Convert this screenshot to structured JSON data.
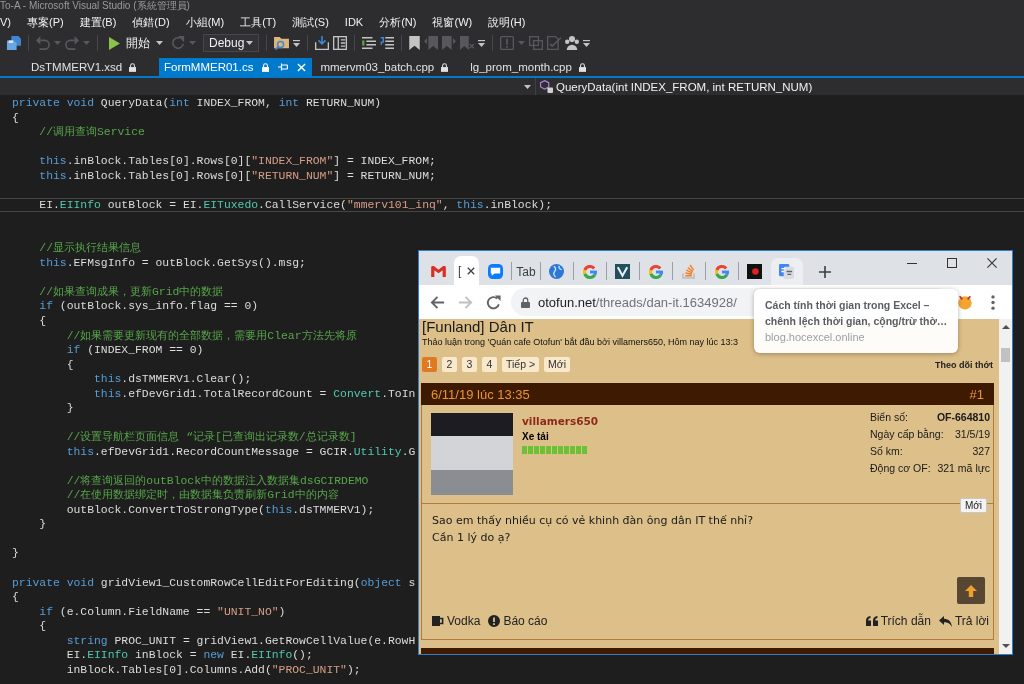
{
  "window": {
    "title": "To-A - Microsoft Visual Studio (系統管理員)"
  },
  "menu": [
    "V)",
    "專案(P)",
    "建置(B)",
    "偵錯(D)",
    "小組(M)",
    "工具(T)",
    "測試(S)",
    "IDK",
    "分析(N)",
    "視窗(W)",
    "說明(H)"
  ],
  "toolbar": {
    "groups": [
      [
        {
          "kind": "save",
          "disabled": false,
          "dropdown": false
        }
      ],
      [
        {
          "kind": "undo",
          "disabled": true,
          "dropdown": true
        },
        {
          "kind": "redo",
          "disabled": true,
          "dropdown": true
        }
      ],
      [
        {
          "kind": "start",
          "label": "開始",
          "disabled": false,
          "dropdown": true
        },
        {
          "kind": "restart",
          "disabled": true,
          "dropdown": true
        },
        {
          "kind": "combo",
          "value": "Debug",
          "disabled": false,
          "dropdown": true
        }
      ],
      [
        {
          "kind": "find",
          "disabled": false,
          "dropdown": false
        },
        {
          "kind": "overflow",
          "disabled": false,
          "dropdown": false
        }
      ],
      [
        {
          "kind": "tray",
          "disabled": false,
          "dropdown": false
        },
        {
          "kind": "panel",
          "disabled": false,
          "dropdown": false
        }
      ],
      [
        {
          "kind": "comment",
          "disabled": false,
          "dropdown": false
        },
        {
          "kind": "uncomment",
          "disabled": false,
          "dropdown": false
        }
      ],
      [
        {
          "kind": "bookmark",
          "disabled": false,
          "dropdown": false
        },
        {
          "kind": "bookmark_prev",
          "disabled": true,
          "dropdown": false
        },
        {
          "kind": "bookmark_next",
          "disabled": true,
          "dropdown": false
        },
        {
          "kind": "bookmark_clear",
          "disabled": true,
          "dropdown": false
        },
        {
          "kind": "overflow",
          "disabled": false,
          "dropdown": false
        }
      ],
      [
        {
          "kind": "alert",
          "disabled": true,
          "dropdown": true
        },
        {
          "kind": "layers",
          "disabled": true,
          "dropdown": false
        },
        {
          "kind": "checklist",
          "disabled": true,
          "dropdown": false
        },
        {
          "kind": "team",
          "disabled": false,
          "dropdown": false
        },
        {
          "kind": "overflow",
          "disabled": false,
          "dropdown": false
        }
      ]
    ]
  },
  "tabs": [
    {
      "title": "DsTMMERV1.xsd",
      "selected": false,
      "locked": true
    },
    {
      "title": "FormMMER01.cs",
      "selected": true,
      "locked": true
    },
    {
      "title": "mmervm03_batch.cpp",
      "selected": false,
      "locked": true
    },
    {
      "title": "lg_prom_month.cpp",
      "selected": false,
      "locked": true
    }
  ],
  "navigation": {
    "member": "QueryData(int INDEX_FROM, int RETURN_NUM)"
  },
  "editor": {
    "lines": [
      {
        "kind": "code",
        "current": false,
        "tokens": [
          {
            "kind": "keyword",
            "text": "private void"
          },
          {
            "kind": "plain",
            "text": " QueryData("
          },
          {
            "kind": "keyword",
            "text": "int"
          },
          {
            "kind": "plain",
            "text": " INDEX_FROM, "
          },
          {
            "kind": "keyword",
            "text": "int"
          },
          {
            "kind": "plain",
            "text": " RETURN_NUM)"
          }
        ]
      },
      {
        "kind": "code",
        "current": false,
        "tokens": [
          {
            "kind": "plain",
            "text": "{"
          }
        ]
      },
      {
        "kind": "code",
        "current": false,
        "tokens": [
          {
            "kind": "comment",
            "text": "    //调用查询Service"
          }
        ]
      },
      {
        "kind": "blank",
        "current": false
      },
      {
        "kind": "code",
        "current": false,
        "tokens": [
          {
            "kind": "keyword",
            "text": "    this"
          },
          {
            "kind": "plain",
            "text": ".inBlock.Tables[0].Rows[0]["
          },
          {
            "kind": "string",
            "text": "\"INDEX_FROM\""
          },
          {
            "kind": "plain",
            "text": "] = INDEX_FROM;"
          }
        ]
      },
      {
        "kind": "code",
        "current": false,
        "tokens": [
          {
            "kind": "keyword",
            "text": "    this"
          },
          {
            "kind": "plain",
            "text": ".inBlock.Tables[0].Rows[0]["
          },
          {
            "kind": "string",
            "text": "\"RETURN_NUM\""
          },
          {
            "kind": "plain",
            "text": "] = RETURN_NUM;"
          }
        ]
      },
      {
        "kind": "blank",
        "current": false
      },
      {
        "kind": "code",
        "current": true,
        "tokens": [
          {
            "kind": "plain",
            "text": "    EI."
          },
          {
            "kind": "type",
            "text": "EIInfo"
          },
          {
            "kind": "plain",
            "text": " outBlock = EI."
          },
          {
            "kind": "type",
            "text": "EITuxedo"
          },
          {
            "kind": "plain",
            "text": ".CallService("
          },
          {
            "kind": "string",
            "text": "\"mmerv101_inq\""
          },
          {
            "kind": "plain",
            "text": ", "
          },
          {
            "kind": "keyword",
            "text": "this"
          },
          {
            "kind": "plain",
            "text": ".inBlock);"
          }
        ]
      },
      {
        "kind": "blank",
        "current": false
      },
      {
        "kind": "blank",
        "current": false
      },
      {
        "kind": "code",
        "current": false,
        "tokens": [
          {
            "kind": "comment",
            "text": "    //显示执行结果信息"
          }
        ]
      },
      {
        "kind": "code",
        "current": false,
        "tokens": [
          {
            "kind": "keyword",
            "text": "    this"
          },
          {
            "kind": "plain",
            "text": ".EFMsgInfo = outBlock.GetSys().msg;"
          }
        ]
      },
      {
        "kind": "blank",
        "current": false
      },
      {
        "kind": "code",
        "current": false,
        "tokens": [
          {
            "kind": "comment",
            "text": "    //如果查询成果，更新Grid中的数据"
          }
        ]
      },
      {
        "kind": "code",
        "current": false,
        "tokens": [
          {
            "kind": "keyword",
            "text": "    if"
          },
          {
            "kind": "plain",
            "text": " (outBlock.sys_info.flag == 0)"
          }
        ]
      },
      {
        "kind": "code",
        "current": false,
        "tokens": [
          {
            "kind": "plain",
            "text": "    {"
          }
        ]
      },
      {
        "kind": "code",
        "current": false,
        "tokens": [
          {
            "kind": "comment",
            "text": "        //如果需要更新现有的全部数据，需要用Clear方法先将原"
          }
        ]
      },
      {
        "kind": "code",
        "current": false,
        "tokens": [
          {
            "kind": "keyword",
            "text": "        if"
          },
          {
            "kind": "plain",
            "text": " (INDEX_FROM == 0)"
          }
        ]
      },
      {
        "kind": "code",
        "current": false,
        "tokens": [
          {
            "kind": "plain",
            "text": "        {"
          }
        ]
      },
      {
        "kind": "code",
        "current": false,
        "tokens": [
          {
            "kind": "keyword",
            "text": "            this"
          },
          {
            "kind": "plain",
            "text": ".dsTMMERV1.Clear();"
          }
        ]
      },
      {
        "kind": "code",
        "current": false,
        "tokens": [
          {
            "kind": "keyword",
            "text": "            this"
          },
          {
            "kind": "plain",
            "text": ".efDevGrid1.TotalRecordCount = "
          },
          {
            "kind": "type",
            "text": "Convert"
          },
          {
            "kind": "plain",
            "text": ".ToIn"
          }
        ]
      },
      {
        "kind": "code",
        "current": false,
        "tokens": [
          {
            "kind": "plain",
            "text": "        }"
          }
        ]
      },
      {
        "kind": "blank",
        "current": false
      },
      {
        "kind": "code",
        "current": false,
        "tokens": [
          {
            "kind": "comment",
            "text": "        //设置导航栏页面信息 “记录[已查询出记录数/总记录数]"
          }
        ]
      },
      {
        "kind": "code",
        "current": false,
        "tokens": [
          {
            "kind": "keyword",
            "text": "        this"
          },
          {
            "kind": "plain",
            "text": ".efDevGrid1.RecordCountMessage = GCIR."
          },
          {
            "kind": "type",
            "text": "Utility"
          },
          {
            "kind": "plain",
            "text": ".G"
          }
        ]
      },
      {
        "kind": "blank",
        "current": false
      },
      {
        "kind": "code",
        "current": false,
        "tokens": [
          {
            "kind": "comment",
            "text": "        //将查询返回的outBlock中的数据注入数据集dsGCIRDEMO"
          }
        ]
      },
      {
        "kind": "code",
        "current": false,
        "tokens": [
          {
            "kind": "comment",
            "text": "        //在使用数据绑定时，由数据集负责刷新Grid中的内容"
          }
        ]
      },
      {
        "kind": "code",
        "current": false,
        "tokens": [
          {
            "kind": "plain",
            "text": "        outBlock.ConvertToStrongType("
          },
          {
            "kind": "keyword",
            "text": "this"
          },
          {
            "kind": "plain",
            "text": ".dsTMMERV1);"
          }
        ]
      },
      {
        "kind": "code",
        "current": false,
        "tokens": [
          {
            "kind": "plain",
            "text": "    }"
          }
        ]
      },
      {
        "kind": "blank",
        "current": false
      },
      {
        "kind": "code",
        "current": false,
        "tokens": [
          {
            "kind": "plain",
            "text": "}"
          }
        ]
      },
      {
        "kind": "blank",
        "current": false
      },
      {
        "kind": "code",
        "current": false,
        "tokens": [
          {
            "kind": "keyword",
            "text": "private void"
          },
          {
            "kind": "plain",
            "text": " gridView1_CustomRowCellEditForEditing("
          },
          {
            "kind": "keyword",
            "text": "object"
          },
          {
            "kind": "plain",
            "text": " s"
          }
        ]
      },
      {
        "kind": "code",
        "current": false,
        "tokens": [
          {
            "kind": "plain",
            "text": "{"
          }
        ]
      },
      {
        "kind": "code",
        "current": false,
        "tokens": [
          {
            "kind": "keyword",
            "text": "    if"
          },
          {
            "kind": "plain",
            "text": " (e.Column.FieldName == "
          },
          {
            "kind": "string",
            "text": "\"UNIT_NO\""
          },
          {
            "kind": "plain",
            "text": ")"
          }
        ]
      },
      {
        "kind": "code",
        "current": false,
        "tokens": [
          {
            "kind": "plain",
            "text": "    {"
          }
        ]
      },
      {
        "kind": "code",
        "current": false,
        "tokens": [
          {
            "kind": "keyword",
            "text": "        string"
          },
          {
            "kind": "plain",
            "text": " PROC_UNIT = gridView1.GetRowCellValue(e.RowH"
          }
        ]
      },
      {
        "kind": "code",
        "current": false,
        "tokens": [
          {
            "kind": "plain",
            "text": "        EI."
          },
          {
            "kind": "type",
            "text": "EIInfo"
          },
          {
            "kind": "plain",
            "text": " inBlock = "
          },
          {
            "kind": "keyword",
            "text": "new"
          },
          {
            "kind": "plain",
            "text": " EI."
          },
          {
            "kind": "type",
            "text": "EIInfo"
          },
          {
            "kind": "plain",
            "text": "();"
          }
        ]
      },
      {
        "kind": "code",
        "current": false,
        "tokens": [
          {
            "kind": "plain",
            "text": "        inBlock.Tables[0].Columns.Add("
          },
          {
            "kind": "string",
            "text": "\"PROC_UNIT\""
          },
          {
            "kind": "plain",
            "text": ");"
          }
        ]
      }
    ]
  },
  "browser": {
    "tabs": [
      {
        "kind": "mail",
        "selected": false,
        "hovered": false
      },
      {
        "kind": "title",
        "title": "[",
        "selected": true,
        "hovered": false
      },
      {
        "kind": "chat",
        "selected": false,
        "hovered": false
      },
      {
        "kind": "title",
        "title": "Tab",
        "selected": false,
        "hovered": false
      },
      {
        "kind": "globe",
        "selected": false,
        "hovered": false
      },
      {
        "kind": "g",
        "selected": false,
        "hovered": false
      },
      {
        "kind": "chevron",
        "selected": false,
        "hovered": false
      },
      {
        "kind": "g",
        "selected": false,
        "hovered": false
      },
      {
        "kind": "stack",
        "selected": false,
        "hovered": false
      },
      {
        "kind": "g",
        "selected": false,
        "hovered": false
      },
      {
        "kind": "record",
        "selected": false,
        "hovered": false
      },
      {
        "kind": "translate",
        "selected": false,
        "hovered": true
      }
    ],
    "tooltip": {
      "title_lines": [
        "Cách tính thời gian trong Excel –",
        "chênh lệch thời gian, cộng/trừ thờ…"
      ],
      "domain": "blog.hocexcel.online"
    },
    "nav_buttons": [
      {
        "kind": "back",
        "disabled": false
      },
      {
        "kind": "forward",
        "disabled": true
      },
      {
        "kind": "reload",
        "disabled": false
      }
    ],
    "address": {
      "host": "otofun.net",
      "path": "/threads/dan-it.1634928/"
    },
    "page": {
      "title": "[Funland] Dân IT",
      "meta": "Thảo luận trong 'Quán cafe Otofun' bắt đầu bởi villamers650, Hôm nay lúc 13:3",
      "pages": [
        {
          "label": "1",
          "selected": true
        },
        {
          "label": "2",
          "selected": false
        },
        {
          "label": "3",
          "selected": false
        },
        {
          "label": "4",
          "selected": false
        },
        {
          "label": "Tiếp >",
          "selected": false
        },
        {
          "label": "Mới",
          "selected": false
        }
      ],
      "follow": "Theo dõi thớt",
      "post": {
        "date": "6/11/19 lúc 13:35",
        "number": "#1",
        "author": "villamers650",
        "rank": "Xe tải",
        "level": 1,
        "stats": [
          {
            "label": "Biển số:",
            "value": "OF-664810",
            "bold": true
          },
          {
            "label": "Ngày cấp bằng:",
            "value": "31/5/19",
            "bold": false
          },
          {
            "label": "Số km:",
            "value": "327",
            "bold": false
          },
          {
            "label": "Động cơ OF:",
            "value": "321 mã lực",
            "bold": false
          }
        ],
        "badge": "Mới",
        "message": [
          "Sao em thấy nhiều cụ có vẻ khinh đàn ông dân IT thế nhỉ?",
          "Cần 1 lý do ạ?"
        ],
        "left_actions": [
          {
            "kind": "vodka",
            "label": "Vodka"
          },
          {
            "kind": "report",
            "label": "Báo cáo"
          }
        ],
        "right_actions": [
          {
            "kind": "quote",
            "label": "Trích dẫn"
          },
          {
            "kind": "reply",
            "label": "Trả lời"
          }
        ]
      }
    }
  }
}
